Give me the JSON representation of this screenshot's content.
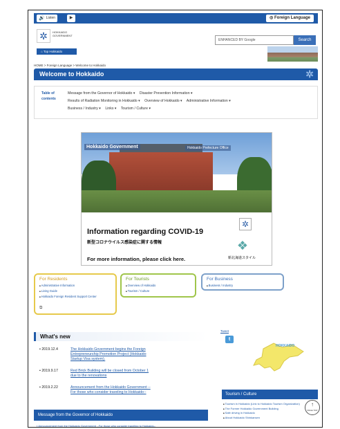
{
  "topbar": {
    "listen": "Listen",
    "foreign": "Foreign Language"
  },
  "header": {
    "logo_text": "HOKKAIDO GOVERNMENT",
    "top_button": "Top Hokkaido",
    "search_placeholder": "ENHANCED BY Google",
    "search_button": "Search"
  },
  "breadcrumb": "HOME  >  Foreign Language  >  Welcome to Hokkaido",
  "page_title": "Welcome to Hokkaido",
  "toc": {
    "label": "Table of contents",
    "items": [
      "Message from the Governor of Hokkaido ▾",
      "Disaster Prevention Information ▾",
      "Results of Radiation Monitoring in Hokkaido ▾",
      "Overview of Hokkaido ▾",
      "Administrative Information ▾",
      "Business / Industry ▾",
      "Links ▾",
      "Tourism / Culture ▾"
    ]
  },
  "banner": {
    "gov": "Hokkaido Government",
    "gov2": "Hokkaido Prefecture Office",
    "covid_title": "Information regarding COVID-19",
    "covid_jp": "新型コロナウイルス感染症に関する情報",
    "more": "For more information, please click here.",
    "brand": "新北海道スタイル"
  },
  "categories": {
    "residents": {
      "title": "For Residents",
      "items": [
        "Administrative Information",
        "Living Guide",
        "Hokkaido Foreign Resident Support Center"
      ]
    },
    "tourists": {
      "title": "For Tourists",
      "items": [
        "Overview of Hokkaido",
        "Tourism / Culture"
      ]
    },
    "business": {
      "title": "For Business",
      "items": [
        "Business / Industry"
      ]
    }
  },
  "news": {
    "title": "What's new",
    "items": [
      {
        "date": "2019.12.4",
        "text": "The Hokkaido Government begins the Foreign Entrepreneurship Promotion Project (Hokkaido Startup Visa system)."
      },
      {
        "date": "2019.9.17",
        "text": "Red Brick Building will be closed from October 1 due to the renovations"
      },
      {
        "date": "2019.2.22",
        "text": "Announcement from the Hokkaido Government --For those who consider traveling to Hokkaido--"
      }
    ]
  },
  "twitter": {
    "label": "Tweet"
  },
  "map_label": "HOKKAIDO",
  "governor": {
    "title": "Message from the Governor of Hokkaido",
    "link": "Announcement from the Hokkaido Government --For those who consider traveling to Hokkaido--"
  },
  "tourism": {
    "title": "Tourism / Culture",
    "items": [
      "Tourism in Hokkaido (Link to Hokkaido Tourism Organization)",
      "The Former Hokkaido Government Building",
      "Safe driving in Hokkaido",
      "About Hokkaido Shinkansen"
    ]
  },
  "pagetop": "PAGE TOP"
}
